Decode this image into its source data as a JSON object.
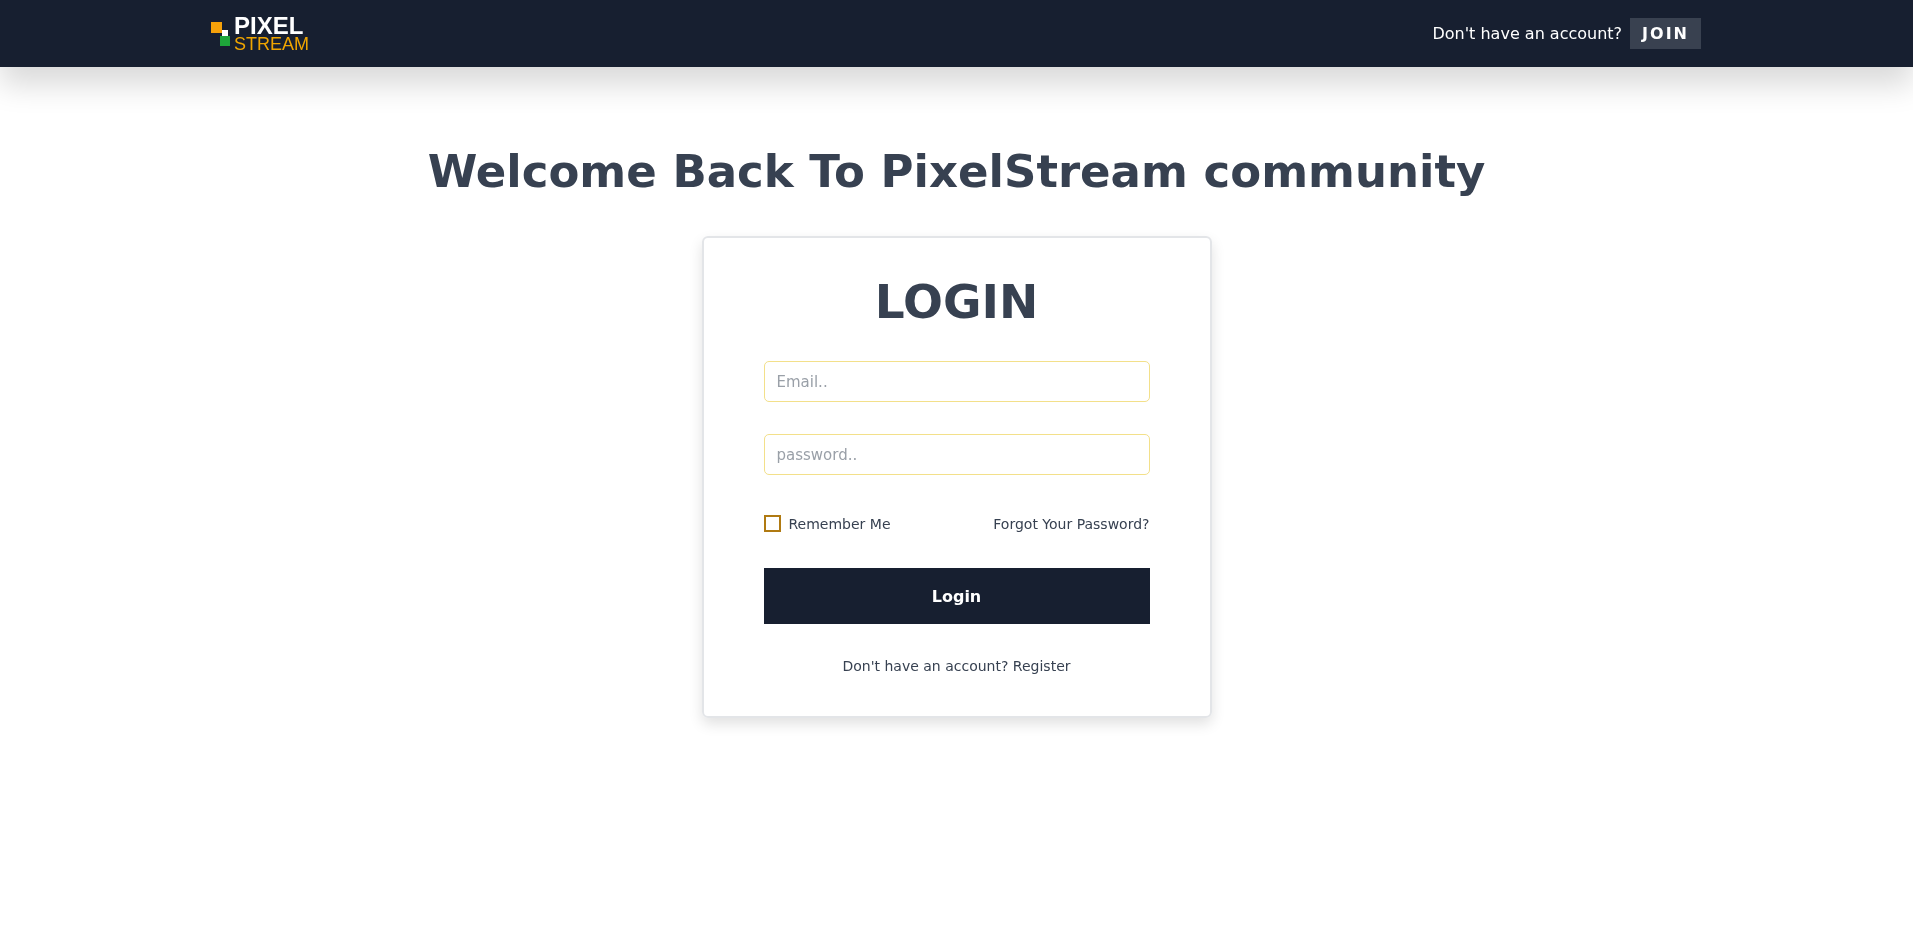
{
  "navbar": {
    "logo": {
      "line_1": "PIXEL",
      "line_2": "STREAM"
    },
    "prompt": "Don't have an account?",
    "join_button": "JOIN"
  },
  "heading": "Welcome Back To PixelStream community",
  "login_card": {
    "title": "LOGIN",
    "fields": [
      {
        "placeholder": "Email.."
      },
      {
        "placeholder": "password.."
      }
    ],
    "remember_me": {
      "label": "Remember Me",
      "checked": false
    },
    "forgot_link": "Forgot Your Password?",
    "submit_button": "Login",
    "register_prompt": "Don't have an account?",
    "register_link": "Register"
  }
}
